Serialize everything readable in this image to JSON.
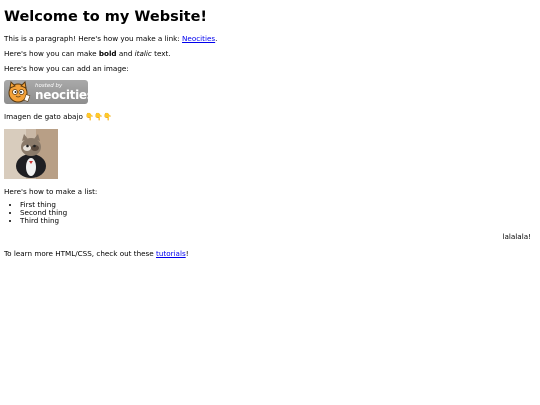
{
  "heading": "Welcome to my Website!",
  "paragraph_intro": {
    "before": "This is a paragraph! Here's how you make a link: ",
    "link": "Neocities",
    "after": "."
  },
  "paragraph_format": {
    "before": "Here's how you can make ",
    "bold": "bold",
    "middle": " and ",
    "italic": "italic",
    "after": " text."
  },
  "image_intro": "Here's how you can add an image:",
  "badge": {
    "hosted_by": "hosted by",
    "name": "neocities"
  },
  "cat_caption": "Imagen de gato abajo 👇👇👇",
  "list_intro": "Here's how to make a list:",
  "list_items": [
    "First thing",
    "Second thing",
    "Third thing"
  ],
  "right_text": "lalalala!",
  "footer": {
    "before": "To learn more HTML/CSS, check out these ",
    "link": "tutorials",
    "after": "!"
  },
  "colors": {
    "link": "#0000ee",
    "badge_bg": "#9a9a9a",
    "cat_orange": "#f4a23a"
  }
}
